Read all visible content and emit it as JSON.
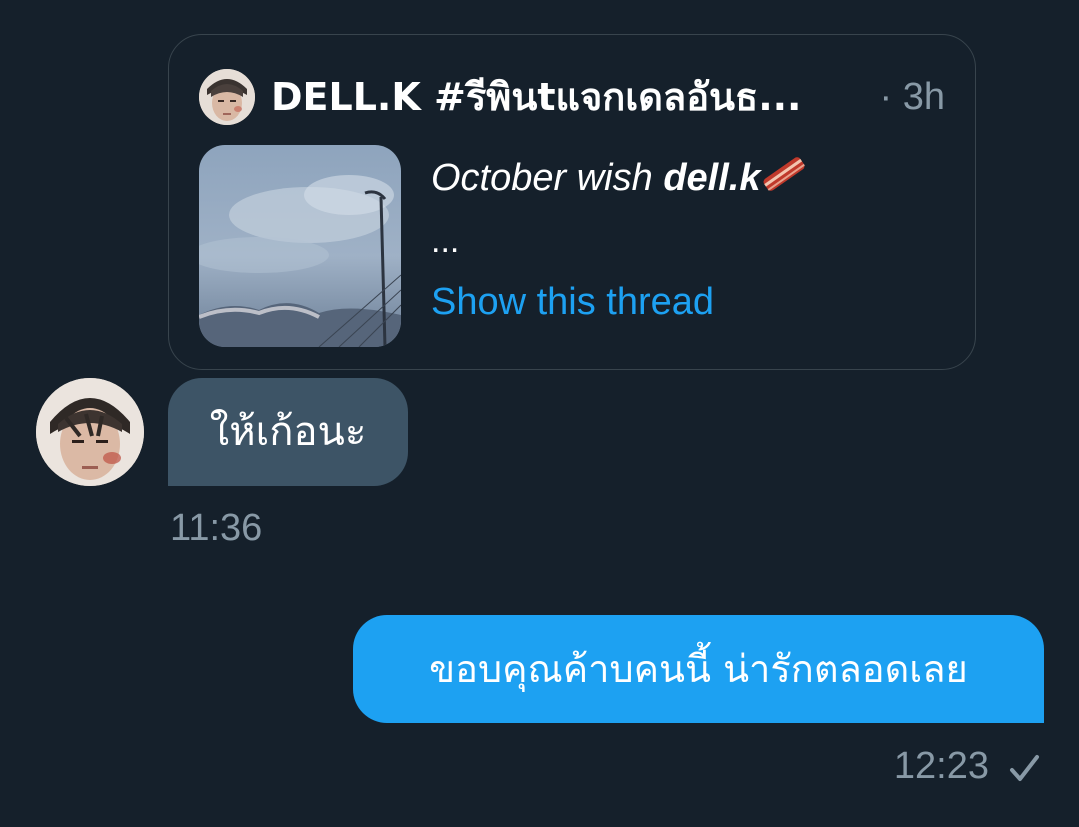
{
  "quoted_tweet": {
    "author": "DELL.K #รีพินtแจกเดลอันธ...",
    "time": "· 3h",
    "text_plain": "October wish ",
    "text_bold": "dell.k",
    "emoji": "🥓",
    "ellipsis": "...",
    "show_thread": "Show this thread"
  },
  "incoming": {
    "message": "ให้เก้อนะ",
    "time": "11:36"
  },
  "outgoing": {
    "message": "ขอบคุณค้าบคนนี้ น่ารักตลอดเลย",
    "time": "12:23",
    "status_icon": "check-icon"
  },
  "colors": {
    "background": "#15202b",
    "accent": "#1da1f2",
    "incoming_bubble": "#3d5466",
    "muted": "#8899a6",
    "border": "#38444d"
  }
}
